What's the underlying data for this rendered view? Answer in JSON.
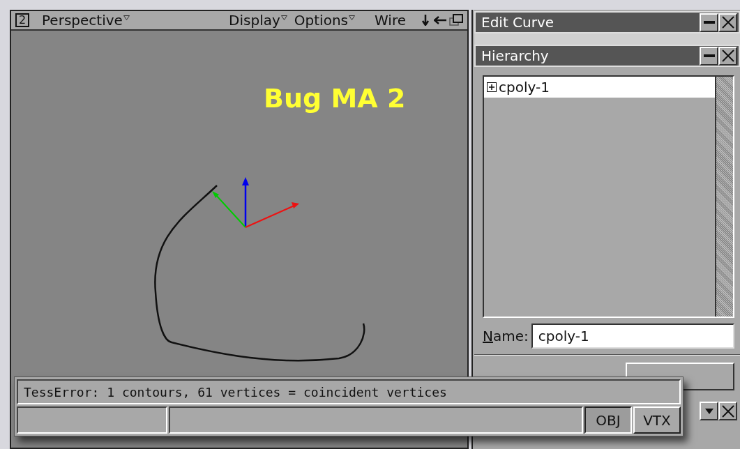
{
  "viewport": {
    "number": "2",
    "camera": "Perspective",
    "menus": [
      "Display",
      "Options"
    ],
    "shading": "Wire",
    "overlay_text": "Bug MA 2"
  },
  "edit_curve": {
    "title": "Edit Curve"
  },
  "hierarchy": {
    "title": "Hierarchy",
    "items": [
      {
        "label": "cpoly-1",
        "expanded": false,
        "selected": true
      }
    ],
    "name_label": "Name:",
    "name_value": "cpoly-1"
  },
  "status": {
    "message": "TessError: 1 contours, 61 vertices = coincident vertices",
    "modes": [
      {
        "label": "OBJ",
        "selected": true
      },
      {
        "label": "VTX",
        "selected": false
      }
    ]
  }
}
